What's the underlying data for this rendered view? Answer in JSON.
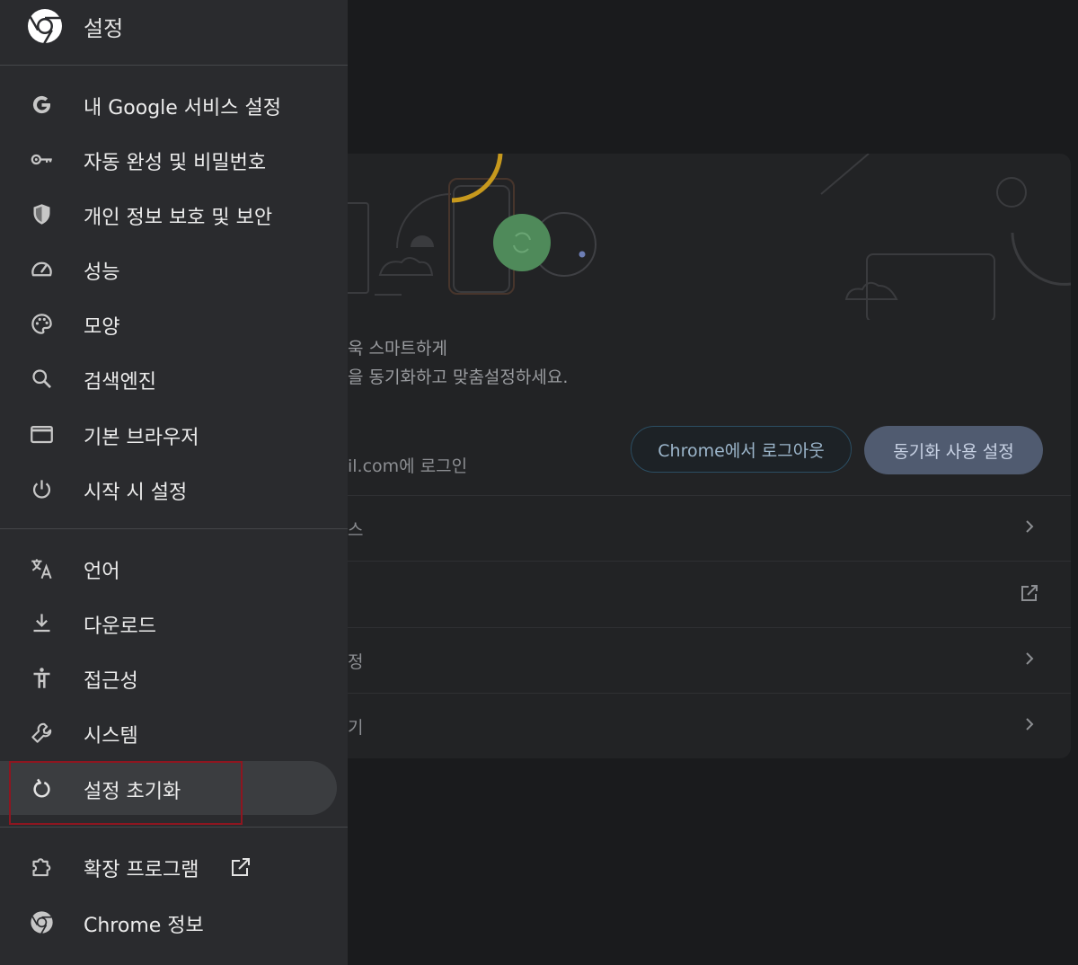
{
  "sidebar": {
    "title": "설정",
    "items": [
      {
        "label": "내 Google 서비스 설정",
        "icon": "google-g-icon"
      },
      {
        "label": "자동 완성 및 비밀번호",
        "icon": "key-icon"
      },
      {
        "label": "개인 정보 보호 및 보안",
        "icon": "shield-icon"
      },
      {
        "label": "성능",
        "icon": "speedometer-icon"
      },
      {
        "label": "모양",
        "icon": "palette-icon"
      },
      {
        "label": "검색엔진",
        "icon": "search-icon"
      },
      {
        "label": "기본 브라우저",
        "icon": "browser-window-icon"
      },
      {
        "label": "시작 시 설정",
        "icon": "power-icon"
      },
      {
        "label": "언어",
        "icon": "translate-icon"
      },
      {
        "label": "다운로드",
        "icon": "download-icon"
      },
      {
        "label": "접근성",
        "icon": "accessibility-icon"
      },
      {
        "label": "시스템",
        "icon": "wrench-icon"
      },
      {
        "label": "설정 초기화",
        "icon": "reset-icon",
        "active": true
      },
      {
        "label": "확장 프로그램",
        "icon": "puzzle-icon"
      },
      {
        "label": "Chrome 정보",
        "icon": "chrome-icon"
      }
    ]
  },
  "main": {
    "sync_title": "욱 스마트하게",
    "sync_subtitle": "을 동기화하고 맞춤설정하세요.",
    "account_text": "il.com에 로그인",
    "logout_button": "Chrome에서 로그아웃",
    "sync_button": "동기화 사용 설정",
    "rows": [
      {
        "label": "스",
        "icon": "chevron-right-icon"
      },
      {
        "label": "",
        "icon": "open-external-icon"
      },
      {
        "label": "정",
        "icon": "chevron-right-icon"
      },
      {
        "label": "기",
        "icon": "chevron-right-icon"
      }
    ]
  },
  "colors": {
    "sidebar_bg": "#2a2b2e",
    "active_item_bg": "#3b3d40",
    "highlight_border": "#8e1620",
    "sync_button_bg": "#505b70",
    "sync_circle_green": "#4f8a5a",
    "accent_gold": "#c7991d"
  }
}
